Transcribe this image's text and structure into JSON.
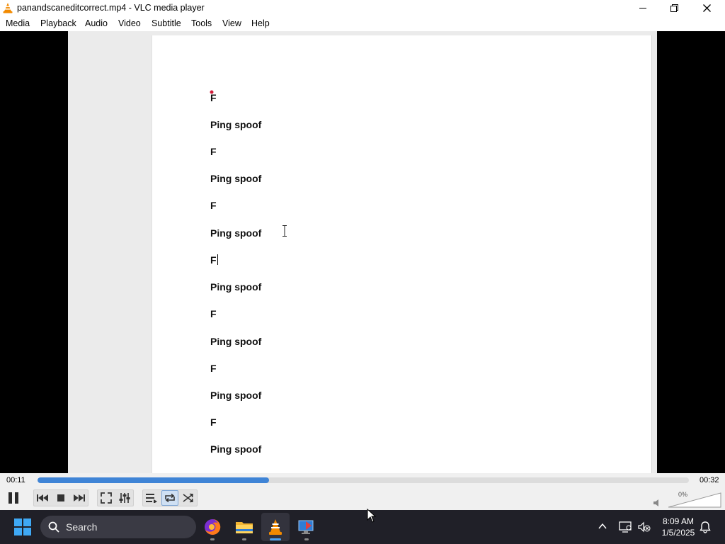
{
  "window": {
    "title": "panandscaneditcorrect.mp4 - VLC media player"
  },
  "menu": [
    "Media",
    "Playback",
    "Audio",
    "Video",
    "Subtitle",
    "Tools",
    "View",
    "Help"
  ],
  "document": {
    "lines": [
      "F",
      "Ping spoof",
      "F",
      "Ping spoof",
      "F",
      "Ping spoof",
      "F",
      "Ping spoof",
      "F",
      "Ping spoof",
      "F",
      "Ping spoof",
      "F",
      "Ping spoof"
    ],
    "caret_line_index": 6
  },
  "player": {
    "elapsed": "00:11",
    "total": "00:32",
    "progress_fraction": 0.355,
    "volume": "0%",
    "accent_color": "#3f84d6"
  },
  "taskbar": {
    "search_placeholder": "Search",
    "time": "8:09 AM",
    "date": "1/5/2025",
    "apps": [
      "firefox-icon",
      "file-explorer-icon",
      "vlc-icon",
      "remote-desktop-icon"
    ]
  }
}
